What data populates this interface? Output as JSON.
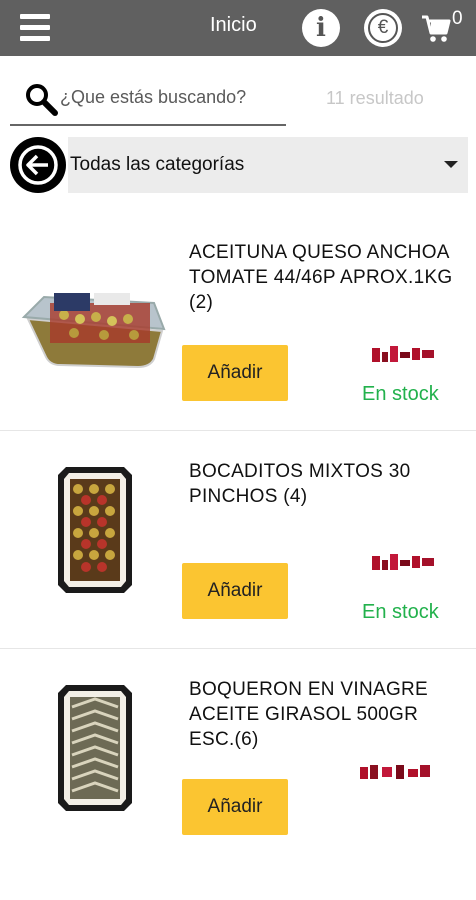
{
  "header": {
    "title": "Inicio",
    "info_glyph": "i",
    "currency_glyph": "€",
    "cart_count": "0"
  },
  "search": {
    "placeholder": "¿Que estás buscando?",
    "result_count": "11 resultado"
  },
  "category_filter": {
    "selected": "Todas las categorías"
  },
  "colors": {
    "topbar": "#606060",
    "accent_button": "#fbc531",
    "stock": "#22b14c",
    "price_obscured": "#b0102a"
  },
  "products": [
    {
      "name": "ACEITUNA QUESO ANCHOA TOMATE 44/46P APROX.1KG (2)",
      "add_label": "Añadir",
      "stock": "En stock"
    },
    {
      "name": "BOCADITOS MIXTOS 30 PINCHOS (4)",
      "add_label": "Añadir",
      "stock": "En stock"
    },
    {
      "name": "BOQUERON EN VINAGRE ACEITE GIRASOL 500GR ESC.(6)",
      "add_label": "Añadir"
    }
  ]
}
